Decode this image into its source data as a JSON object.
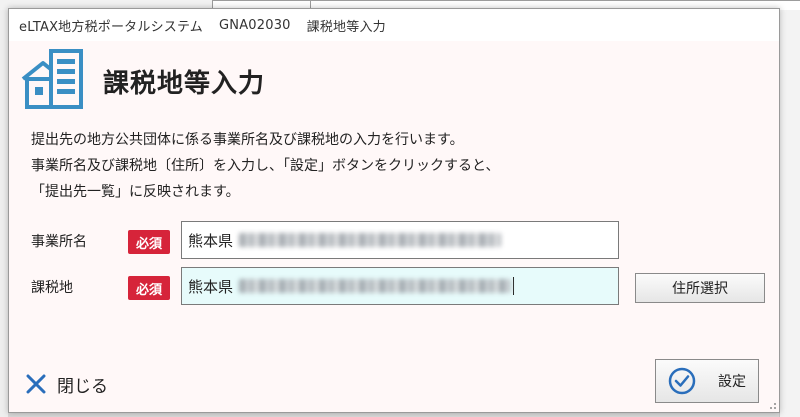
{
  "window": {
    "app_name": "eLTAX地方税ポータルシステム",
    "screen_id": "GNA02030",
    "screen_title": "課税地等入力"
  },
  "header": {
    "title": "課税地等入力",
    "icon": "building-list-icon"
  },
  "description": {
    "line1": "提出先の地方公共団体に係る事業所名及び課税地の入力を行います。",
    "line2": "事業所名及び課税地〔住所〕を入力し、「設定」ボタンをクリックすると、",
    "line3": "「提出先一覧」に反映されます。"
  },
  "form": {
    "business_name": {
      "label": "事業所名",
      "required_badge": "必須",
      "value_visible": "熊本県"
    },
    "tax_location": {
      "label": "課税地",
      "required_badge": "必須",
      "value_visible": "熊本県"
    },
    "address_select_button": "住所選択"
  },
  "footer": {
    "close_label": "閉じる",
    "close_icon": "close-x-icon",
    "set_label": "設定",
    "set_icon": "check-circle-icon"
  },
  "colors": {
    "required_badge": "#d6243a",
    "header_icon": "#3a8fc4",
    "close_icon": "#2a6ebb",
    "dialog_bg": "#fff8f8",
    "active_input_bg": "#e7fbfb"
  }
}
